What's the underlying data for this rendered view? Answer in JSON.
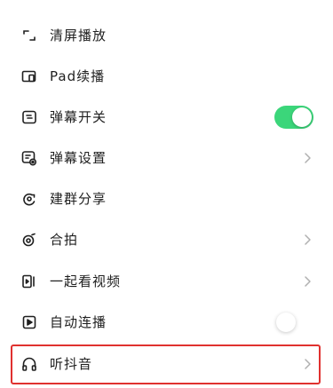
{
  "menu": {
    "items": [
      {
        "label": "清屏播放",
        "icon": "clear-screen-icon",
        "trailing": "none"
      },
      {
        "label": "Pad续播",
        "icon": "pad-icon",
        "trailing": "none"
      },
      {
        "label": "弹幕开关",
        "icon": "danmaku-icon",
        "trailing": "toggle",
        "toggle_on": true
      },
      {
        "label": "弹幕设置",
        "icon": "danmaku-settings-icon",
        "trailing": "chevron"
      },
      {
        "label": "建群分享",
        "icon": "group-share-icon",
        "trailing": "none"
      },
      {
        "label": "合拍",
        "icon": "duet-icon",
        "trailing": "chevron"
      },
      {
        "label": "一起看视频",
        "icon": "watch-together-icon",
        "trailing": "chevron"
      },
      {
        "label": "自动连播",
        "icon": "autoplay-icon",
        "trailing": "toggle",
        "toggle_on": false
      },
      {
        "label": "听抖音",
        "icon": "headphones-icon",
        "trailing": "chevron",
        "highlighted": true
      }
    ]
  },
  "colors": {
    "toggle_on": "#3bd67a",
    "highlight_border": "#e0312f",
    "text": "#1f1f1f",
    "chevron": "#b0b0b0"
  }
}
